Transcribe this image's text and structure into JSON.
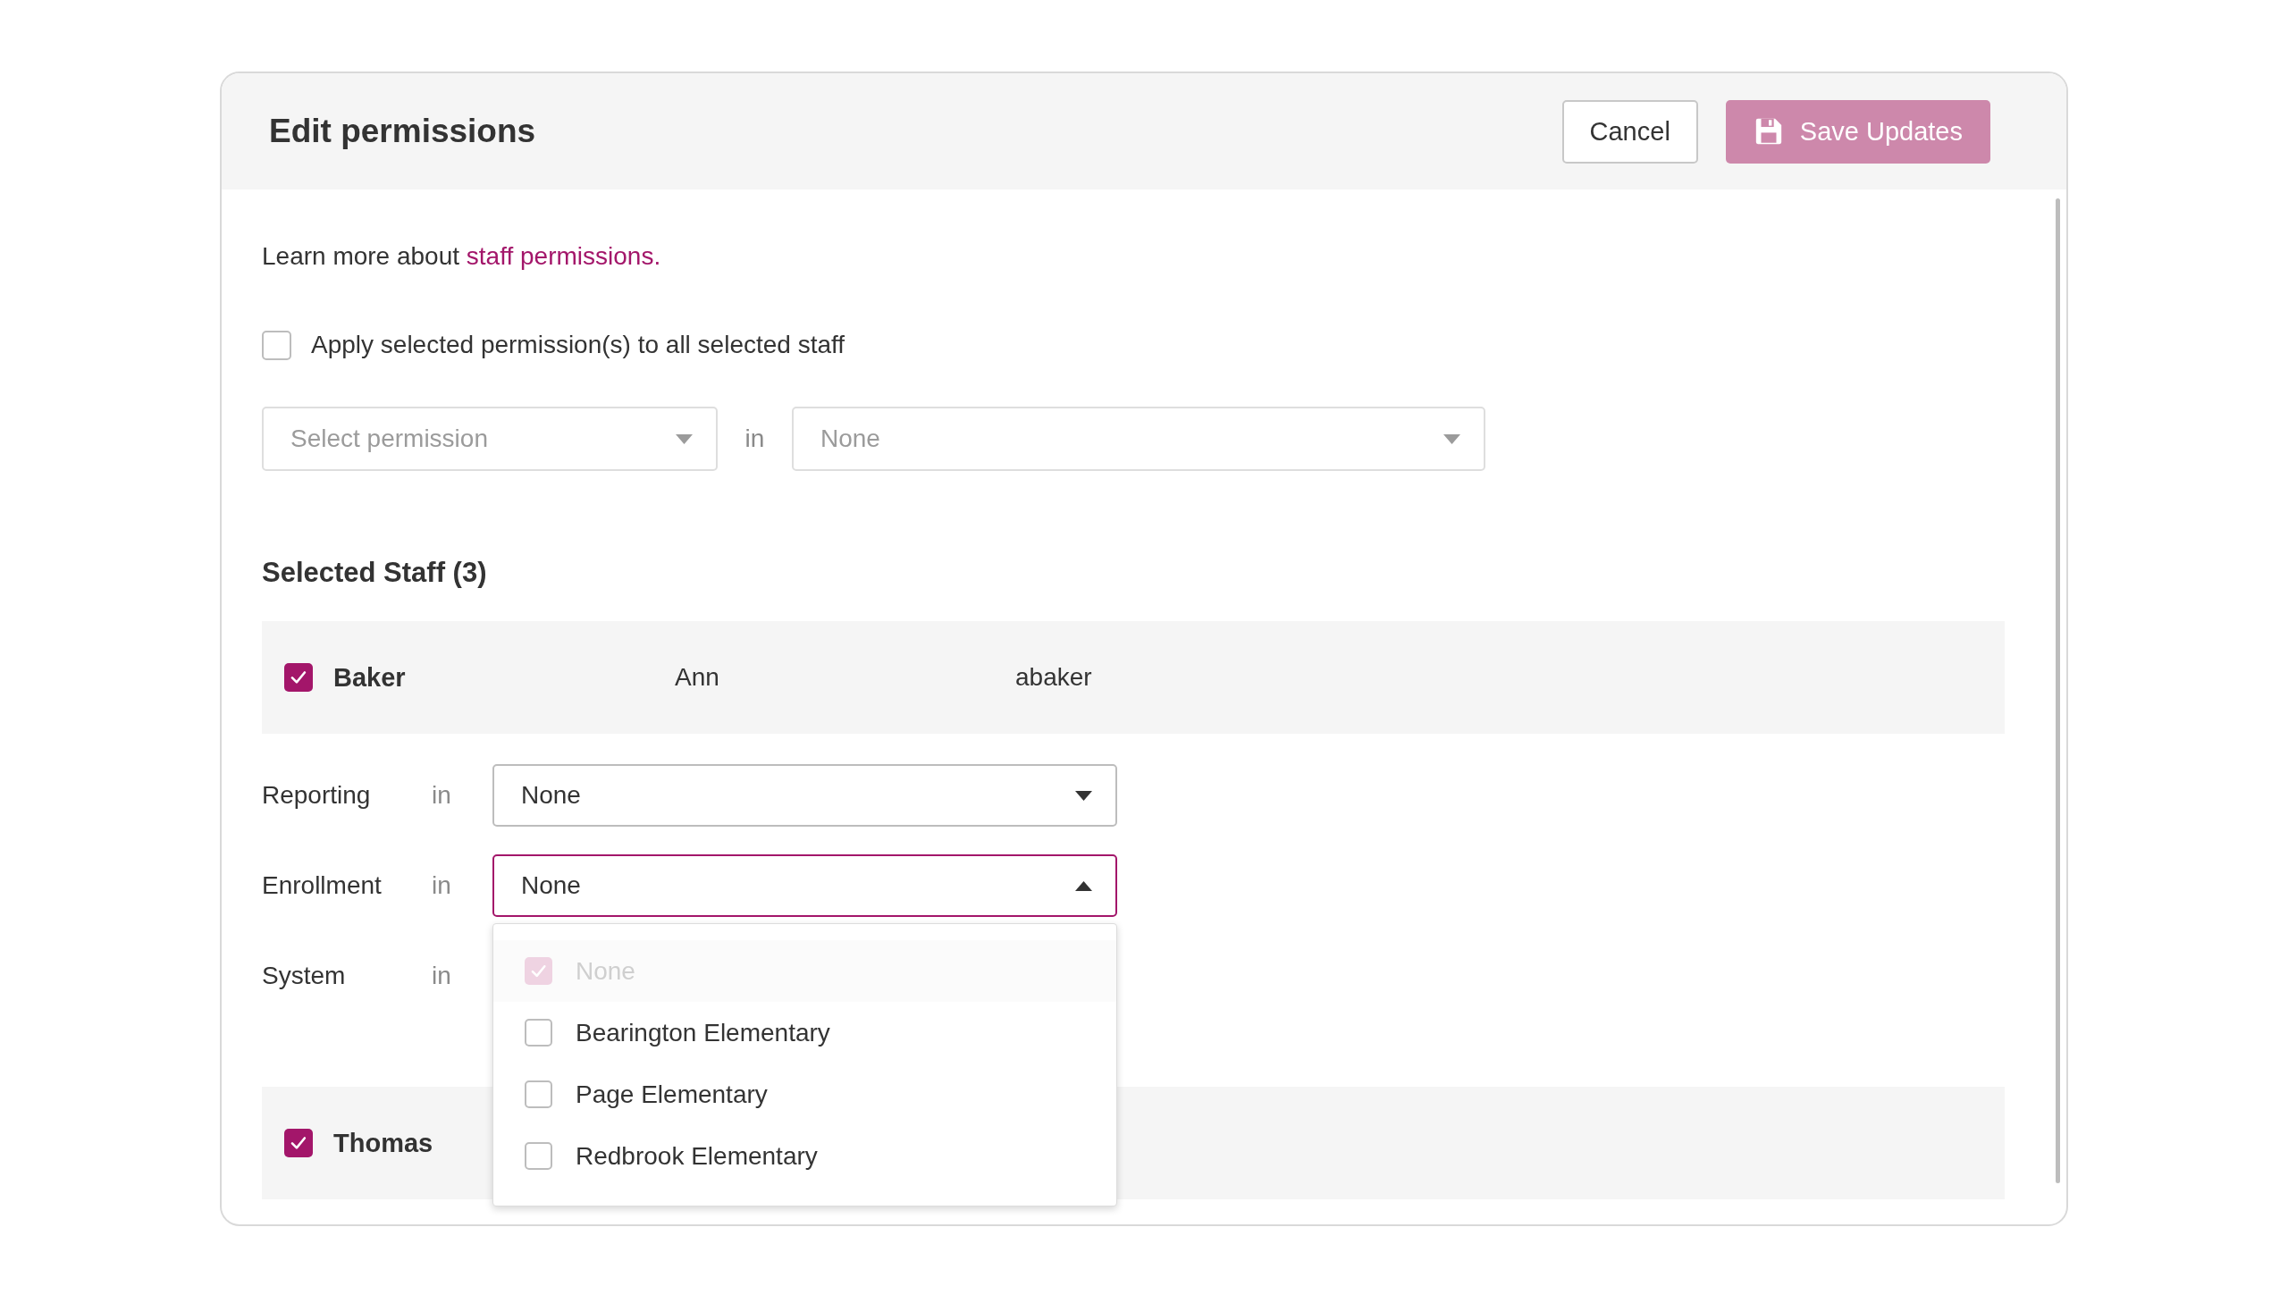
{
  "dialog": {
    "title": "Edit permissions",
    "buttons": [
      {
        "label": "Cancel",
        "kind": "secondary"
      },
      {
        "label": "Save Updates",
        "kind": "primary"
      }
    ]
  },
  "intro": {
    "text": "Learn more about",
    "link": "staff permissions."
  },
  "apply_all": {
    "label": "Apply selected permission(s) to all selected staff",
    "checked": false
  },
  "bulk_assign": {
    "permission_select": {
      "placeholder": "Select permission"
    },
    "connector": "in",
    "scope_select": {
      "placeholder": "None"
    }
  },
  "selected_staff": {
    "heading": "Selected Staff (3)",
    "staff": [
      {
        "last_name": "Baker",
        "first_name": "Ann",
        "username": "abaker",
        "checked": true,
        "permissions": [
          {
            "label": "Reporting",
            "connector": "in",
            "value": "None",
            "open": false
          },
          {
            "label": "Enrollment",
            "connector": "in",
            "value": "None",
            "open": true,
            "options": [
              {
                "label": "None",
                "checked": true,
                "disabled": true
              },
              {
                "label": "Bearington Elementary",
                "checked": false,
                "disabled": false
              },
              {
                "label": "Page Elementary",
                "checked": false,
                "disabled": false
              },
              {
                "label": "Redbrook Elementary",
                "checked": false,
                "disabled": false
              }
            ]
          },
          {
            "label": "System",
            "connector": "in"
          }
        ]
      },
      {
        "last_name": "Thomas",
        "checked": true
      }
    ]
  }
}
